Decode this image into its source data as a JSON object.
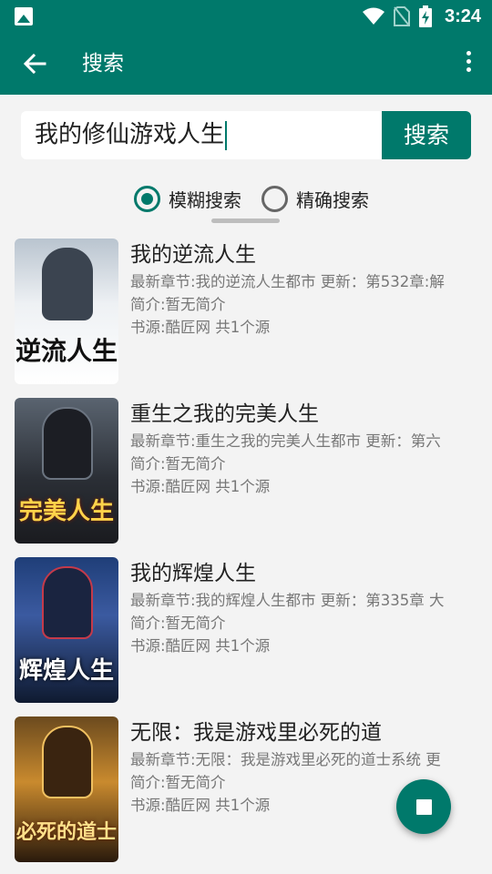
{
  "status_bar": {
    "time": "3:24",
    "icons": [
      "gallery-icon",
      "wifi-icon",
      "no-sim-icon",
      "battery-charging-icon"
    ]
  },
  "app_bar": {
    "title": "搜索",
    "back_icon": "arrow-back-icon",
    "menu_icon": "more-vert-icon"
  },
  "search": {
    "query": "我的修仙游戏人生",
    "button_label": "搜索"
  },
  "search_mode": {
    "options": [
      {
        "label": "模糊搜索",
        "checked": true
      },
      {
        "label": "精确搜索",
        "checked": false
      }
    ]
  },
  "results": [
    {
      "name": "我的逆流人生",
      "latest": "最新章节:我的逆流人生都市 更新：第532章:解",
      "intro": "简介:暂无简介",
      "source": "书源:酷匠网 共1个源",
      "cover_text": "逆流人生"
    },
    {
      "name": "重生之我的完美人生",
      "latest": "最新章节:重生之我的完美人生都市 更新：第六",
      "intro": "简介:暂无简介",
      "source": "书源:酷匠网 共1个源",
      "cover_text": "完美人生"
    },
    {
      "name": "我的辉煌人生",
      "latest": "最新章节:我的辉煌人生都市 更新：第335章 大",
      "intro": "简介:暂无简介",
      "source": "书源:酷匠网 共1个源",
      "cover_text": "辉煌人生"
    },
    {
      "name": "无限：我是游戏里必死的道",
      "latest": "最新章节:无限：我是游戏里必死的道士系统 更",
      "intro": "简介:暂无简介",
      "source": "书源:酷匠网 共1个源",
      "cover_text": "必死的道士"
    }
  ],
  "fab": {
    "icon": "stop-icon"
  },
  "colors": {
    "primary": "#00796b",
    "background": "#f3f3f3"
  }
}
